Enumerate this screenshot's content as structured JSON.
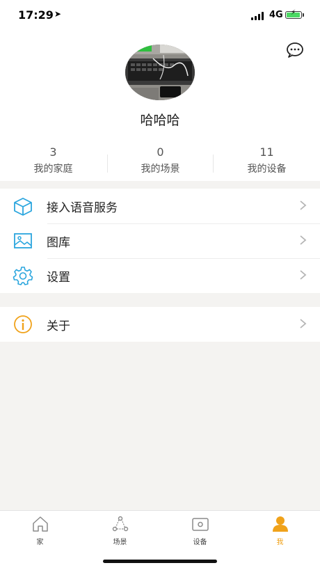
{
  "status_bar": {
    "time": "17:29",
    "network": "4G",
    "location_icon": "location-arrow-icon",
    "battery_color": "#4cd964"
  },
  "header": {
    "message_icon": "chat-bubble-icon"
  },
  "profile": {
    "name": "哈哈哈",
    "avatar_icon": "avatar-photo"
  },
  "stats": [
    {
      "value": "3",
      "label": "我的家庭"
    },
    {
      "value": "0",
      "label": "我的场景"
    },
    {
      "value": "11",
      "label": "我的设备"
    }
  ],
  "menu": [
    {
      "label": "接入语音服务",
      "icon": "cube-icon"
    },
    {
      "label": "图库",
      "icon": "gallery-icon"
    },
    {
      "label": "设置",
      "icon": "gear-icon"
    }
  ],
  "menu_secondary": [
    {
      "label": "关于",
      "icon": "info-icon"
    }
  ],
  "tabs": [
    {
      "label": "家",
      "icon": "home-icon",
      "active": false
    },
    {
      "label": "场景",
      "icon": "scene-icon",
      "active": false
    },
    {
      "label": "设备",
      "icon": "device-icon",
      "active": false
    },
    {
      "label": "我",
      "icon": "user-icon",
      "active": true
    }
  ],
  "colors": {
    "accent": "#f0a21a",
    "icon_blue": "#2ba6de",
    "info_yellow": "#f0a21a",
    "background": "#f4f3f1"
  }
}
